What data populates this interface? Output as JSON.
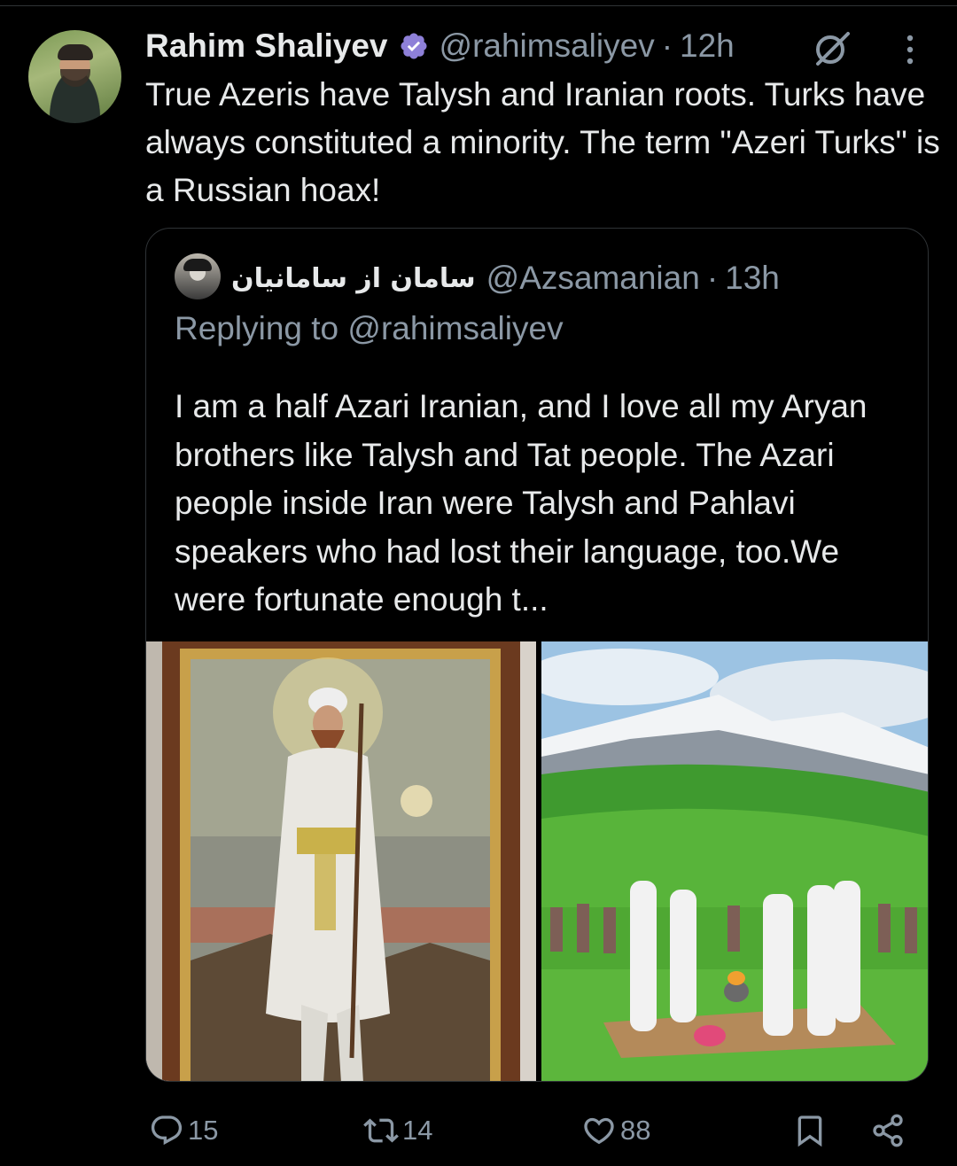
{
  "tweet": {
    "author_name": "Rahim Shaliyev",
    "author_handle": "@rahimsaliyev",
    "separator": "·",
    "time": "12h",
    "text": "True Azeris have Talysh and Iranian roots. Turks have always constituted a minority. The term \"Azeri Turks\" is a Russian hoax!",
    "icons": {
      "verified": "verified-badge-icon",
      "grok": "grok-icon",
      "more": "more-vertical-icon"
    },
    "accent_colors": {
      "verified": "#8e80d8",
      "text": "#e7e9ea",
      "muted": "#8b98a5",
      "border": "#2f3336"
    }
  },
  "quoted": {
    "author_name": "سامان از سامانیان",
    "author_handle": "@Azsamanian",
    "separator": "·",
    "time": "13h",
    "replying_prefix": "Replying to",
    "replying_mention": "@rahimsaliyev",
    "text": "I am a half Azari Iranian, and I love all my Aryan brothers like Talysh and Tat people. The Azari people inside Iran were Talysh and Pahlavi speakers who had lost their language, too.We were fortunate enough t..."
  },
  "actions": {
    "reply_count": "15",
    "retweet_count": "14",
    "like_count": "88",
    "icons": [
      "reply-icon",
      "retweet-icon",
      "like-icon",
      "bookmark-icon",
      "share-icon"
    ]
  }
}
